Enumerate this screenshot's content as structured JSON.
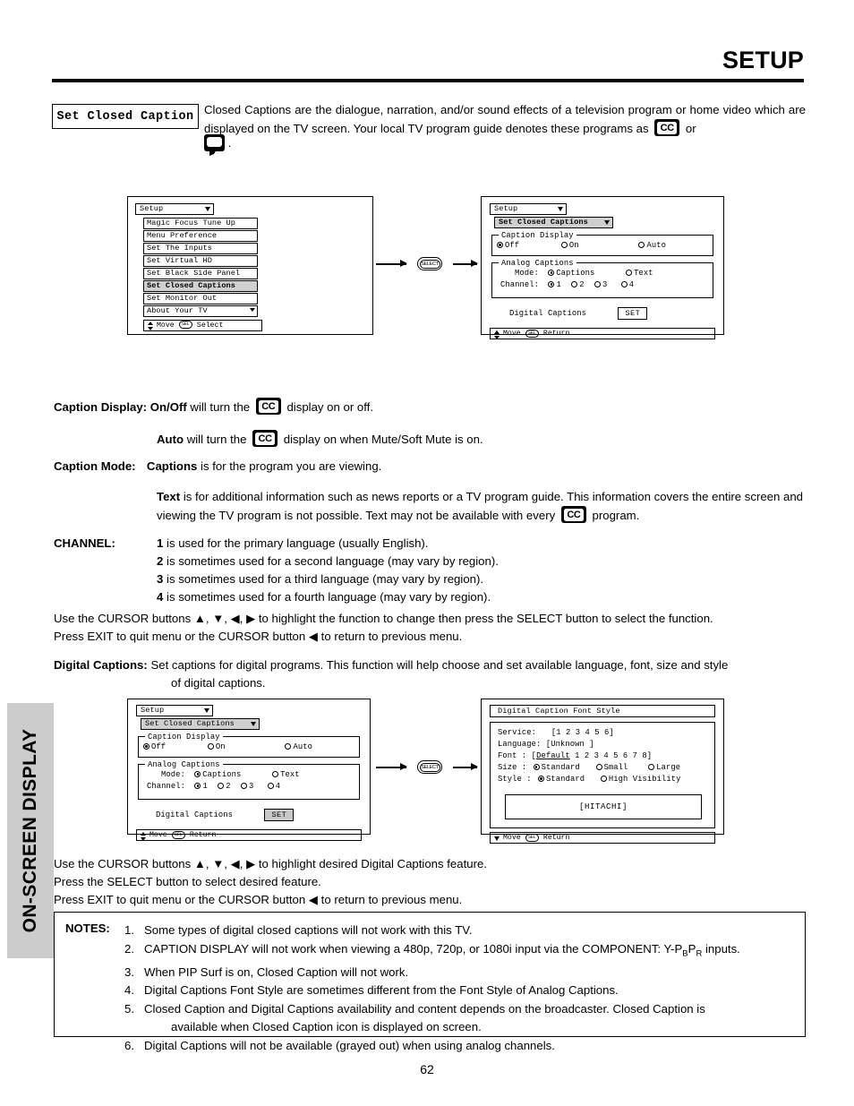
{
  "header": {
    "title": "SETUP"
  },
  "intro": {
    "box_label": "Set Closed Caption",
    "text_part1": "Closed Captions are the dialogue, narration, and/or sound effects of a television program or home video which are displayed on the TV screen.  Your local TV program guide denotes these programs as",
    "cc_icon": "cc-icon",
    "text_part2": "or",
    "bubble_icon": "caption-bubble-icon",
    "text_part3": "."
  },
  "osd": {
    "setup_menu": {
      "title": "Setup",
      "items": [
        "Magic Focus Tune Up",
        "Menu Preference",
        "Set The Inputs",
        "Set Virtual HD",
        "Set Black Side Panel",
        "Set Closed Captions",
        "Set Monitor Out",
        "About Your TV"
      ],
      "selected_index": 5,
      "footer_move": "Move",
      "footer_sel": "SEL",
      "footer_action": "Select"
    },
    "closed_captions": {
      "title": "Setup",
      "subtitle": "Set Closed Captions",
      "caption_display": {
        "legend": "Caption Display",
        "options": [
          "Off",
          "On",
          "Auto"
        ],
        "selected": "Off"
      },
      "analog_captions": {
        "legend": "Analog Captions",
        "mode_label": "Mode:",
        "mode_options": [
          "Captions",
          "Text"
        ],
        "mode_selected": "Captions",
        "channel_label": "Channel:",
        "channel_options": [
          "1",
          "2",
          "3",
          "4"
        ],
        "channel_selected": "1"
      },
      "digital_captions_label": "Digital Captions",
      "set_button": "SET",
      "footer_move": "Move",
      "footer_sel": "SEL",
      "footer_action": "Return"
    },
    "font_style": {
      "title": "Digital Caption Font Style",
      "rows": [
        {
          "label": "Service:",
          "value": "[1 2 3 4 5 6]"
        },
        {
          "label": "Language:",
          "value": "[Unknown    ]"
        },
        {
          "label": "Font    :",
          "value": "[Default 1 2 3 4 5 6 7 8]",
          "underline": "Default"
        },
        {
          "label": "Size    :",
          "radios": [
            "Standard",
            "Small",
            "Large"
          ],
          "selected": "Standard"
        },
        {
          "label": "Style   :",
          "radios": [
            "Standard",
            "High Visibility"
          ],
          "selected": "Standard"
        }
      ],
      "preview": "[HITACHI]",
      "footer_move": "Move",
      "footer_sel": "SEL",
      "footer_action": "Return"
    },
    "flow_select_label": "SELECT"
  },
  "descriptions": {
    "caption_display": {
      "label": "Caption Display:",
      "line1_bold": "On/Off",
      "line1_a": "will turn the",
      "line1_b": "display on or off.",
      "line2_bold": "Auto",
      "line2_a": "will turn the",
      "line2_b": "display on when Mute/Soft Mute is on."
    },
    "caption_mode": {
      "label": "Caption Mode:",
      "line1_bold": "Captions",
      "line1_a": "is for the program you are viewing.",
      "line2_bold": "Text",
      "line2_a": "is for additional information such as news reports or a TV program guide.  This information covers the entire screen and viewing the TV program is not possible.  Text may not be available with every",
      "line2_b": "program."
    },
    "channel": {
      "label": "CHANNEL:",
      "items": [
        {
          "num": "1",
          "text": "is used for the primary language (usually English)."
        },
        {
          "num": "2",
          "text": "is sometimes used for a second language (may vary by region)."
        },
        {
          "num": "3",
          "text": "is sometimes used for a third language (may vary by region)."
        },
        {
          "num": "4",
          "text": "is sometimes used for a fourth language (may vary by region)."
        }
      ]
    },
    "cursor_note_1": "Use the CURSOR buttons ▲, ▼, ◀, ▶ to highlight the function to change then press the SELECT button to select the function.",
    "cursor_note_2": "Press EXIT to quit menu or the CURSOR button ◀ to return to previous menu.",
    "digital_captions": {
      "label": "Digital Captions:",
      "line1": "Set captions for digital programs.  This function will help choose and set  available language, font, size and style",
      "line2": "of digital captions."
    },
    "cursor_note_3": "Use the CURSOR buttons ▲, ▼, ◀, ▶ to highlight desired Digital Captions feature.",
    "cursor_note_4": "Press the SELECT button to select desired feature.",
    "cursor_note_5": "Press EXIT to quit menu or the CURSOR button ◀ to return to previous menu."
  },
  "side_tab": {
    "label": "ON-SCREEN DISPLAY"
  },
  "notes": {
    "label": "NOTES:",
    "items": [
      {
        "num": "1.",
        "text": "Some types of digital closed captions will not work with this TV."
      },
      {
        "num": "2.",
        "text_a": "CAPTION DISPLAY will not work when viewing a 480p, 720p, or 1080i input via the COMPONENT: Y-P",
        "sub_1": "B",
        "text_b": "P",
        "sub_2": "R",
        "text_c": " inputs."
      },
      {
        "num": "3.",
        "text": "When PIP Surf is on, Closed Caption will not work."
      },
      {
        "num": "4.",
        "text": "Digital Captions Font Style are sometimes different from the Font Style of Analog Captions."
      },
      {
        "num": "5.",
        "text": "Closed Caption and Digital Captions availability and content depends on the broadcaster.  Closed Caption is",
        "text2": "available when Closed Caption icon is displayed on screen."
      },
      {
        "num": "6.",
        "text": "Digital Captions will not be available (grayed out) when using analog channels."
      }
    ]
  },
  "footer": {
    "page_number": "62"
  }
}
